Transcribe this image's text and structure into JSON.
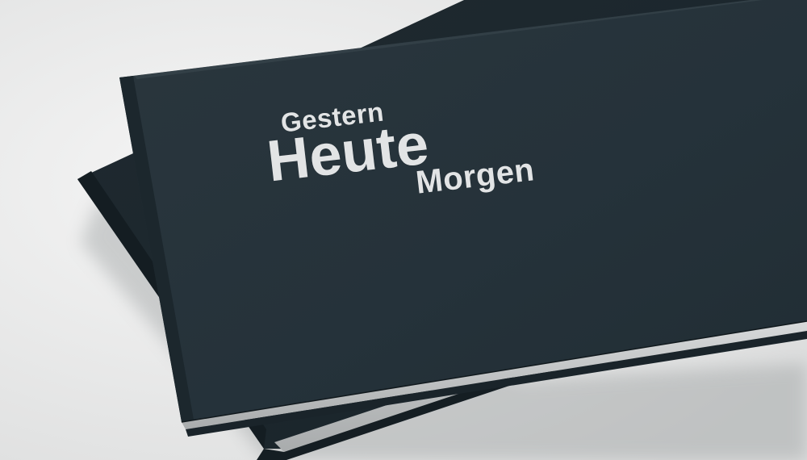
{
  "cover_title": {
    "line_1": "Gestern",
    "line_2": "Heute",
    "line_3": "Morgen"
  },
  "colors": {
    "background": "#ebecec",
    "cover": "#27343b",
    "cover_text": "#e2e4e5",
    "page_edge": "#c9cbcc"
  }
}
